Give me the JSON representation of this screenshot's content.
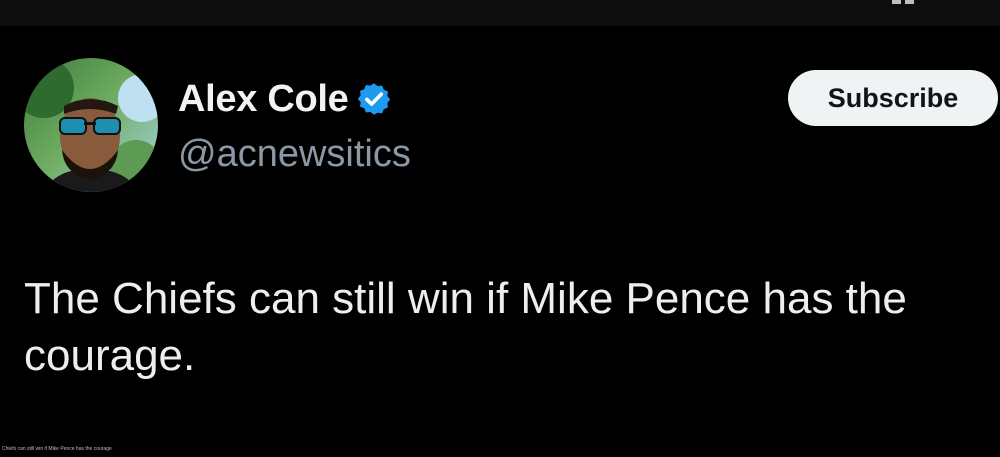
{
  "author": {
    "display_name": "Alex Cole",
    "handle": "@acnewsitics",
    "verified": true,
    "avatar_icon": "profile-photo"
  },
  "actions": {
    "subscribe_label": "Subscribe"
  },
  "tweet": {
    "text": "The Chiefs can still win if Mike Pence has the courage."
  },
  "footer": {
    "caption": "Chiefs can still win if Mike Pence has the courage"
  },
  "colors": {
    "background": "#000000",
    "name": "#f2f2f2",
    "handle": "#8b98a5",
    "verified_badge": "#1d9bf0",
    "button_bg": "#eff3f4",
    "button_text": "#0f1419"
  }
}
